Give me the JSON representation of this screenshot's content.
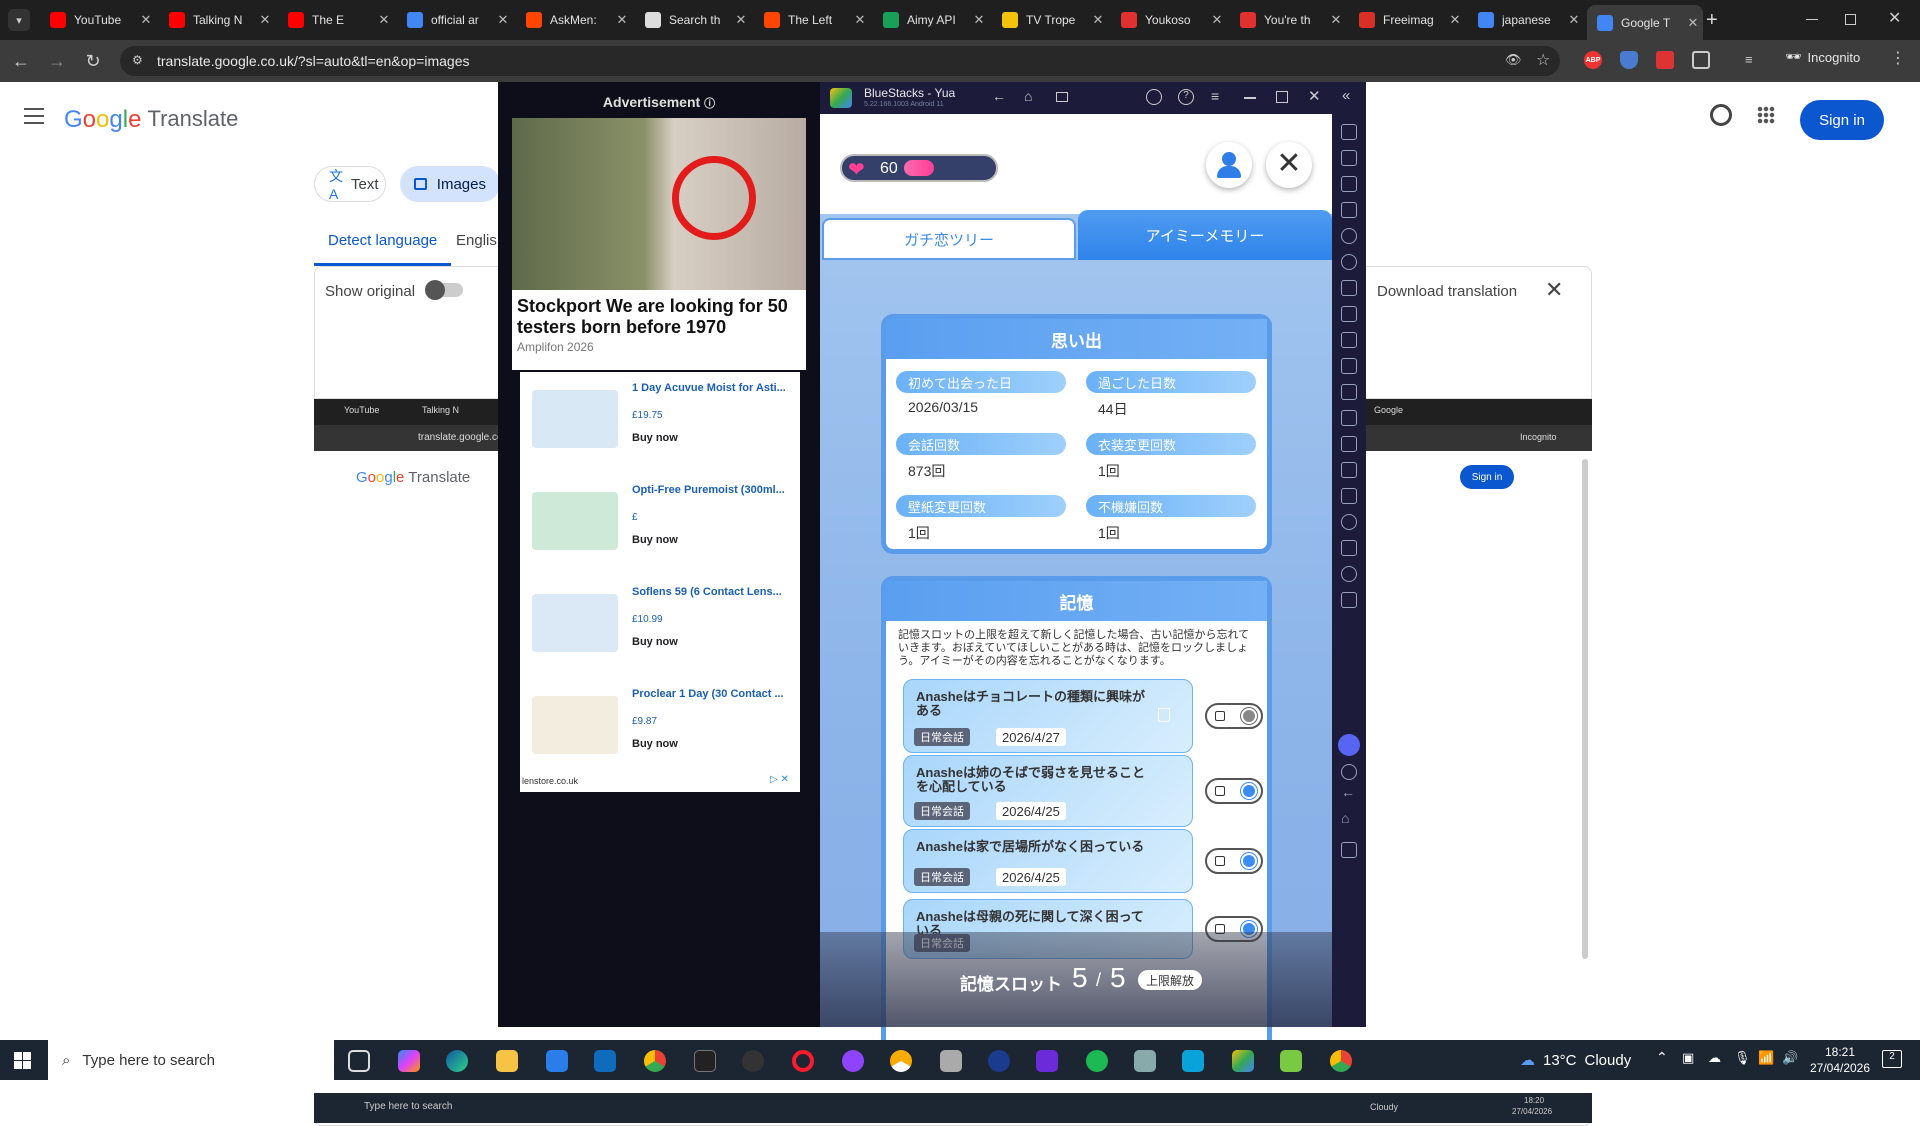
{
  "browser": {
    "tabs": [
      {
        "title": "YouTube",
        "color": "#ff0000"
      },
      {
        "title": "Talking N",
        "color": "#ff0000"
      },
      {
        "title": "The E",
        "color": "#ff0000"
      },
      {
        "title": "official ar",
        "color": "#4285f4"
      },
      {
        "title": "AskMen:",
        "color": "#ff4500"
      },
      {
        "title": "Search th",
        "color": "#dddddd"
      },
      {
        "title": "The Left",
        "color": "#ff4500"
      },
      {
        "title": "Aimy API",
        "color": "#18a058"
      },
      {
        "title": "TV Trope",
        "color": "#f4c20d"
      },
      {
        "title": "Youkoso",
        "color": "#e03030"
      },
      {
        "title": "You're th",
        "color": "#e03030"
      },
      {
        "title": "Freeimag",
        "color": "#d93025"
      },
      {
        "title": "japanese",
        "color": "#4285f4"
      },
      {
        "title": "Google T",
        "color": "#4285f4"
      }
    ],
    "url": "translate.google.co.uk/?sl=auto&tl=en&op=images",
    "incognito_label": "Incognito",
    "abp": "ABP"
  },
  "translate": {
    "logo_google": "Google",
    "logo_translate": "Translate",
    "text_tab": "Text",
    "images_tab": "Images",
    "detect_language": "Detect language",
    "english": "Englis",
    "show_original": "Show original",
    "download_translation": "Download translation",
    "sign_in": "Sign in",
    "inner": {
      "yt": "YouTube",
      "talking": "Talking N",
      "url": "translate.google.co",
      "google_tab": "Google",
      "incognito": "Incognito",
      "sign_in": "Sign in",
      "search": "Type here to search",
      "weather": "Cloudy",
      "time": "18:20",
      "date": "27/04/2026"
    }
  },
  "ad": {
    "header": "Advertisement",
    "headline": "Stockport We are looking for 50 testers born before 1970",
    "sponsor": "Amplifon 2026",
    "products": [
      {
        "name": "1 Day Acuvue Moist for Asti...",
        "price": "£19.75",
        "buy": "Buy now"
      },
      {
        "name": "Opti-Free Puremoist (300ml...",
        "price": "£",
        "buy": "Buy now"
      },
      {
        "name": "Soflens 59 (6 Contact Lens...",
        "price": "£10.99",
        "buy": "Buy now"
      },
      {
        "name": "Proclear 1 Day (30 Contact ...",
        "price": "£9.87",
        "buy": "Buy now"
      }
    ],
    "footer": "lenstore.co.uk"
  },
  "bluestacks": {
    "title": "BlueStacks - Yua",
    "version": "5.22.166.1003  Android 11",
    "hearts": "60",
    "heart_fill": 0.35,
    "tab_left": "ガチ恋ツリー",
    "tab_right": "アイミーメモリー",
    "memories_title": "思い出",
    "stats": [
      {
        "label": "初めて出会った日",
        "value": "2026/03/15"
      },
      {
        "label": "過ごした日数",
        "value": "44日"
      },
      {
        "label": "会話回数",
        "value": "873回"
      },
      {
        "label": "衣装変更回数",
        "value": "1回"
      },
      {
        "label": "壁紙変更回数",
        "value": "1回"
      },
      {
        "label": "不機嫌回数",
        "value": "1回"
      }
    ],
    "memory_title": "記憶",
    "memory_desc": "記憶スロットの上限を超えて新しく記憶した場合、古い記憶から忘れていきます。おぼえていてほしいことがある時は、記憶をロックしましょう。アイミーがその内容を忘れることがなくなります。",
    "memories": [
      {
        "text": "Anasheはチョコレートの種類に興味がある",
        "tag": "日常会話",
        "date": "2026/4/27",
        "locked": false
      },
      {
        "text": "Anasheは姉のそばで弱さを見せることを心配している",
        "tag": "日常会話",
        "date": "2026/4/25",
        "locked": true
      },
      {
        "text": "Anasheは家で居場所がなく困っている",
        "tag": "日常会話",
        "date": "2026/4/25",
        "locked": true
      },
      {
        "text": "Anasheは母親の死に関して深く困っている",
        "tag": "日常会話",
        "date": "",
        "locked": true
      }
    ],
    "slot_label": "記憶スロット",
    "slot_used": "5",
    "slot_sep": "/",
    "slot_max": "5",
    "slot_unlock": "上限解放"
  },
  "taskbar": {
    "search_placeholder": "Type here to search",
    "weather_temp": "13°C",
    "weather_desc": "Cloudy",
    "time": "18:21",
    "date": "27/04/2026",
    "notifications": "2"
  }
}
